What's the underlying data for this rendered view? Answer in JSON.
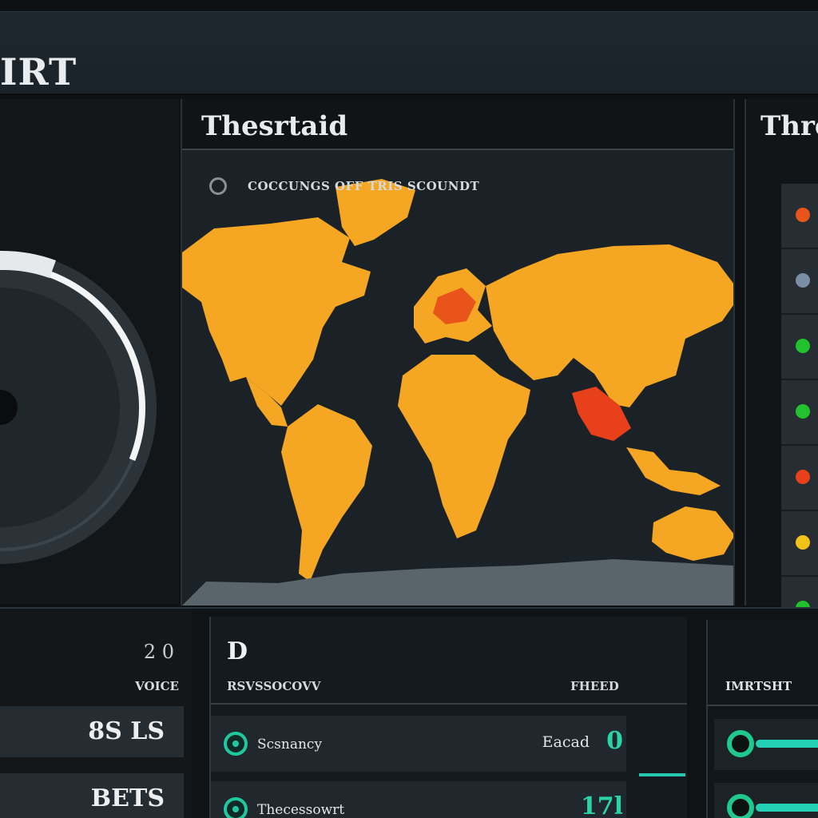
{
  "header": {
    "title": "IRT"
  },
  "dial": {
    "value_fraction": 0.62
  },
  "map_panel": {
    "title": "Thesrtaid",
    "legend_text": "COCCUNGS OFF TRIS SCOUNDT",
    "colors": {
      "land": "#f5a623",
      "hot": "#e8401a",
      "ocean": "#1a2228",
      "antarctica": "#5a646b"
    }
  },
  "right_panel": {
    "title": "Thres",
    "statuses": [
      {
        "color": "#e8541a"
      },
      {
        "color": "#7a8ea6"
      },
      {
        "color": "#22c22e"
      },
      {
        "color": "#22c22e"
      },
      {
        "color": "#e8401a"
      },
      {
        "color": "#f0c21a"
      },
      {
        "color": "#22c22e"
      }
    ]
  },
  "stats": {
    "top_number": "2 0",
    "label": "VOICE",
    "boxes": [
      "8S LS",
      "BETS"
    ]
  },
  "detail": {
    "title": "D",
    "col_left": "RSVSSOCOVV",
    "col_right": "FHEED",
    "rows": [
      {
        "name": "Scsnancy",
        "status": "Eacad",
        "value": "0"
      },
      {
        "name": "Thecessowrt",
        "status": "",
        "value": "17l"
      }
    ]
  },
  "alerts": {
    "head": "IMRTSHT",
    "rows": [
      {},
      {}
    ]
  }
}
